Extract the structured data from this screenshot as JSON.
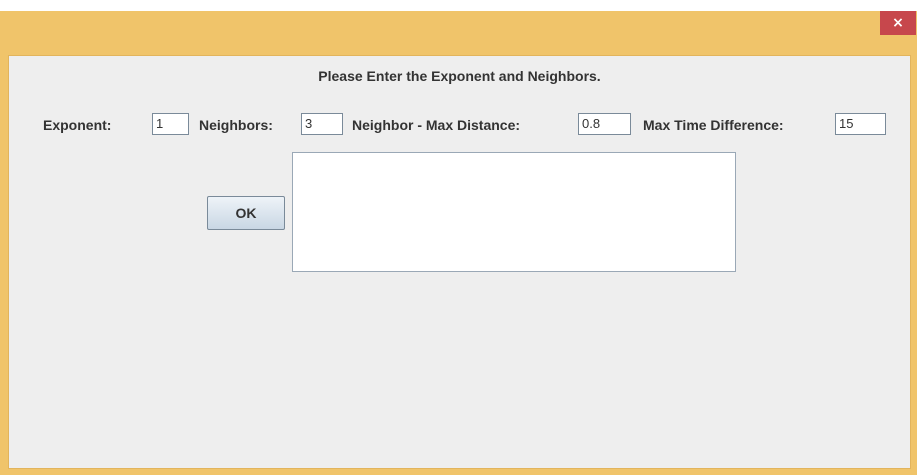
{
  "window": {
    "close_glyph": "×",
    "heading": "Please Enter the Exponent and Neighbors."
  },
  "form": {
    "exponent_label": "Exponent:",
    "exponent_value": "1",
    "neighbors_label": "Neighbors:",
    "neighbors_value": "3",
    "max_distance_label": "Neighbor - Max Distance:",
    "max_distance_value": "0.8",
    "max_time_label": "Max Time Difference:",
    "max_time_value": "15"
  },
  "actions": {
    "ok_label": "OK"
  },
  "output": {
    "text": ""
  },
  "colors": {
    "title_bar": "#f0c46a",
    "close_button": "#c7474c",
    "client_background": "#eeeeee"
  }
}
